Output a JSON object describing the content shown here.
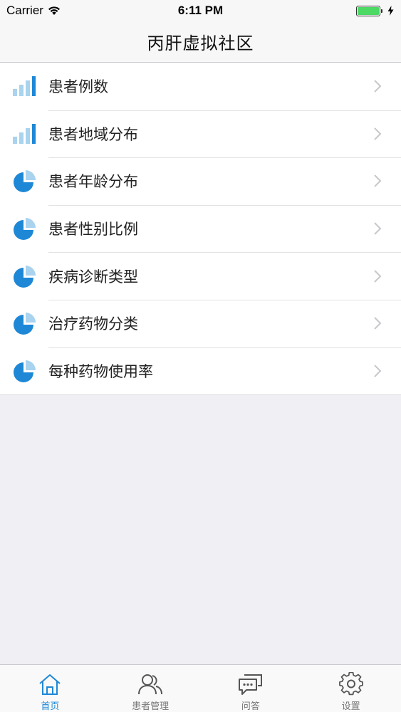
{
  "status_bar": {
    "carrier": "Carrier",
    "time": "6:11 PM"
  },
  "nav": {
    "title": "丙肝虚拟社区"
  },
  "list": {
    "items": [
      {
        "label": "患者例数",
        "icon": "bar-chart-icon"
      },
      {
        "label": "患者地域分布",
        "icon": "bar-chart-icon"
      },
      {
        "label": "患者年龄分布",
        "icon": "pie-chart-icon"
      },
      {
        "label": "患者性别比例",
        "icon": "pie-chart-icon"
      },
      {
        "label": "疾病诊断类型",
        "icon": "pie-chart-icon"
      },
      {
        "label": "治疗药物分类",
        "icon": "pie-chart-icon"
      },
      {
        "label": "每种药物使用率",
        "icon": "pie-chart-icon"
      }
    ]
  },
  "tab_bar": {
    "tabs": [
      {
        "label": "首页",
        "icon": "home-icon",
        "active": true
      },
      {
        "label": "患者管理",
        "icon": "users-icon",
        "active": false
      },
      {
        "label": "问答",
        "icon": "chat-icon",
        "active": false
      },
      {
        "label": "设置",
        "icon": "gear-icon",
        "active": false
      }
    ]
  },
  "colors": {
    "accent": "#1e88d6",
    "icon_light": "#a9d3ef",
    "battery": "#4cd964"
  }
}
